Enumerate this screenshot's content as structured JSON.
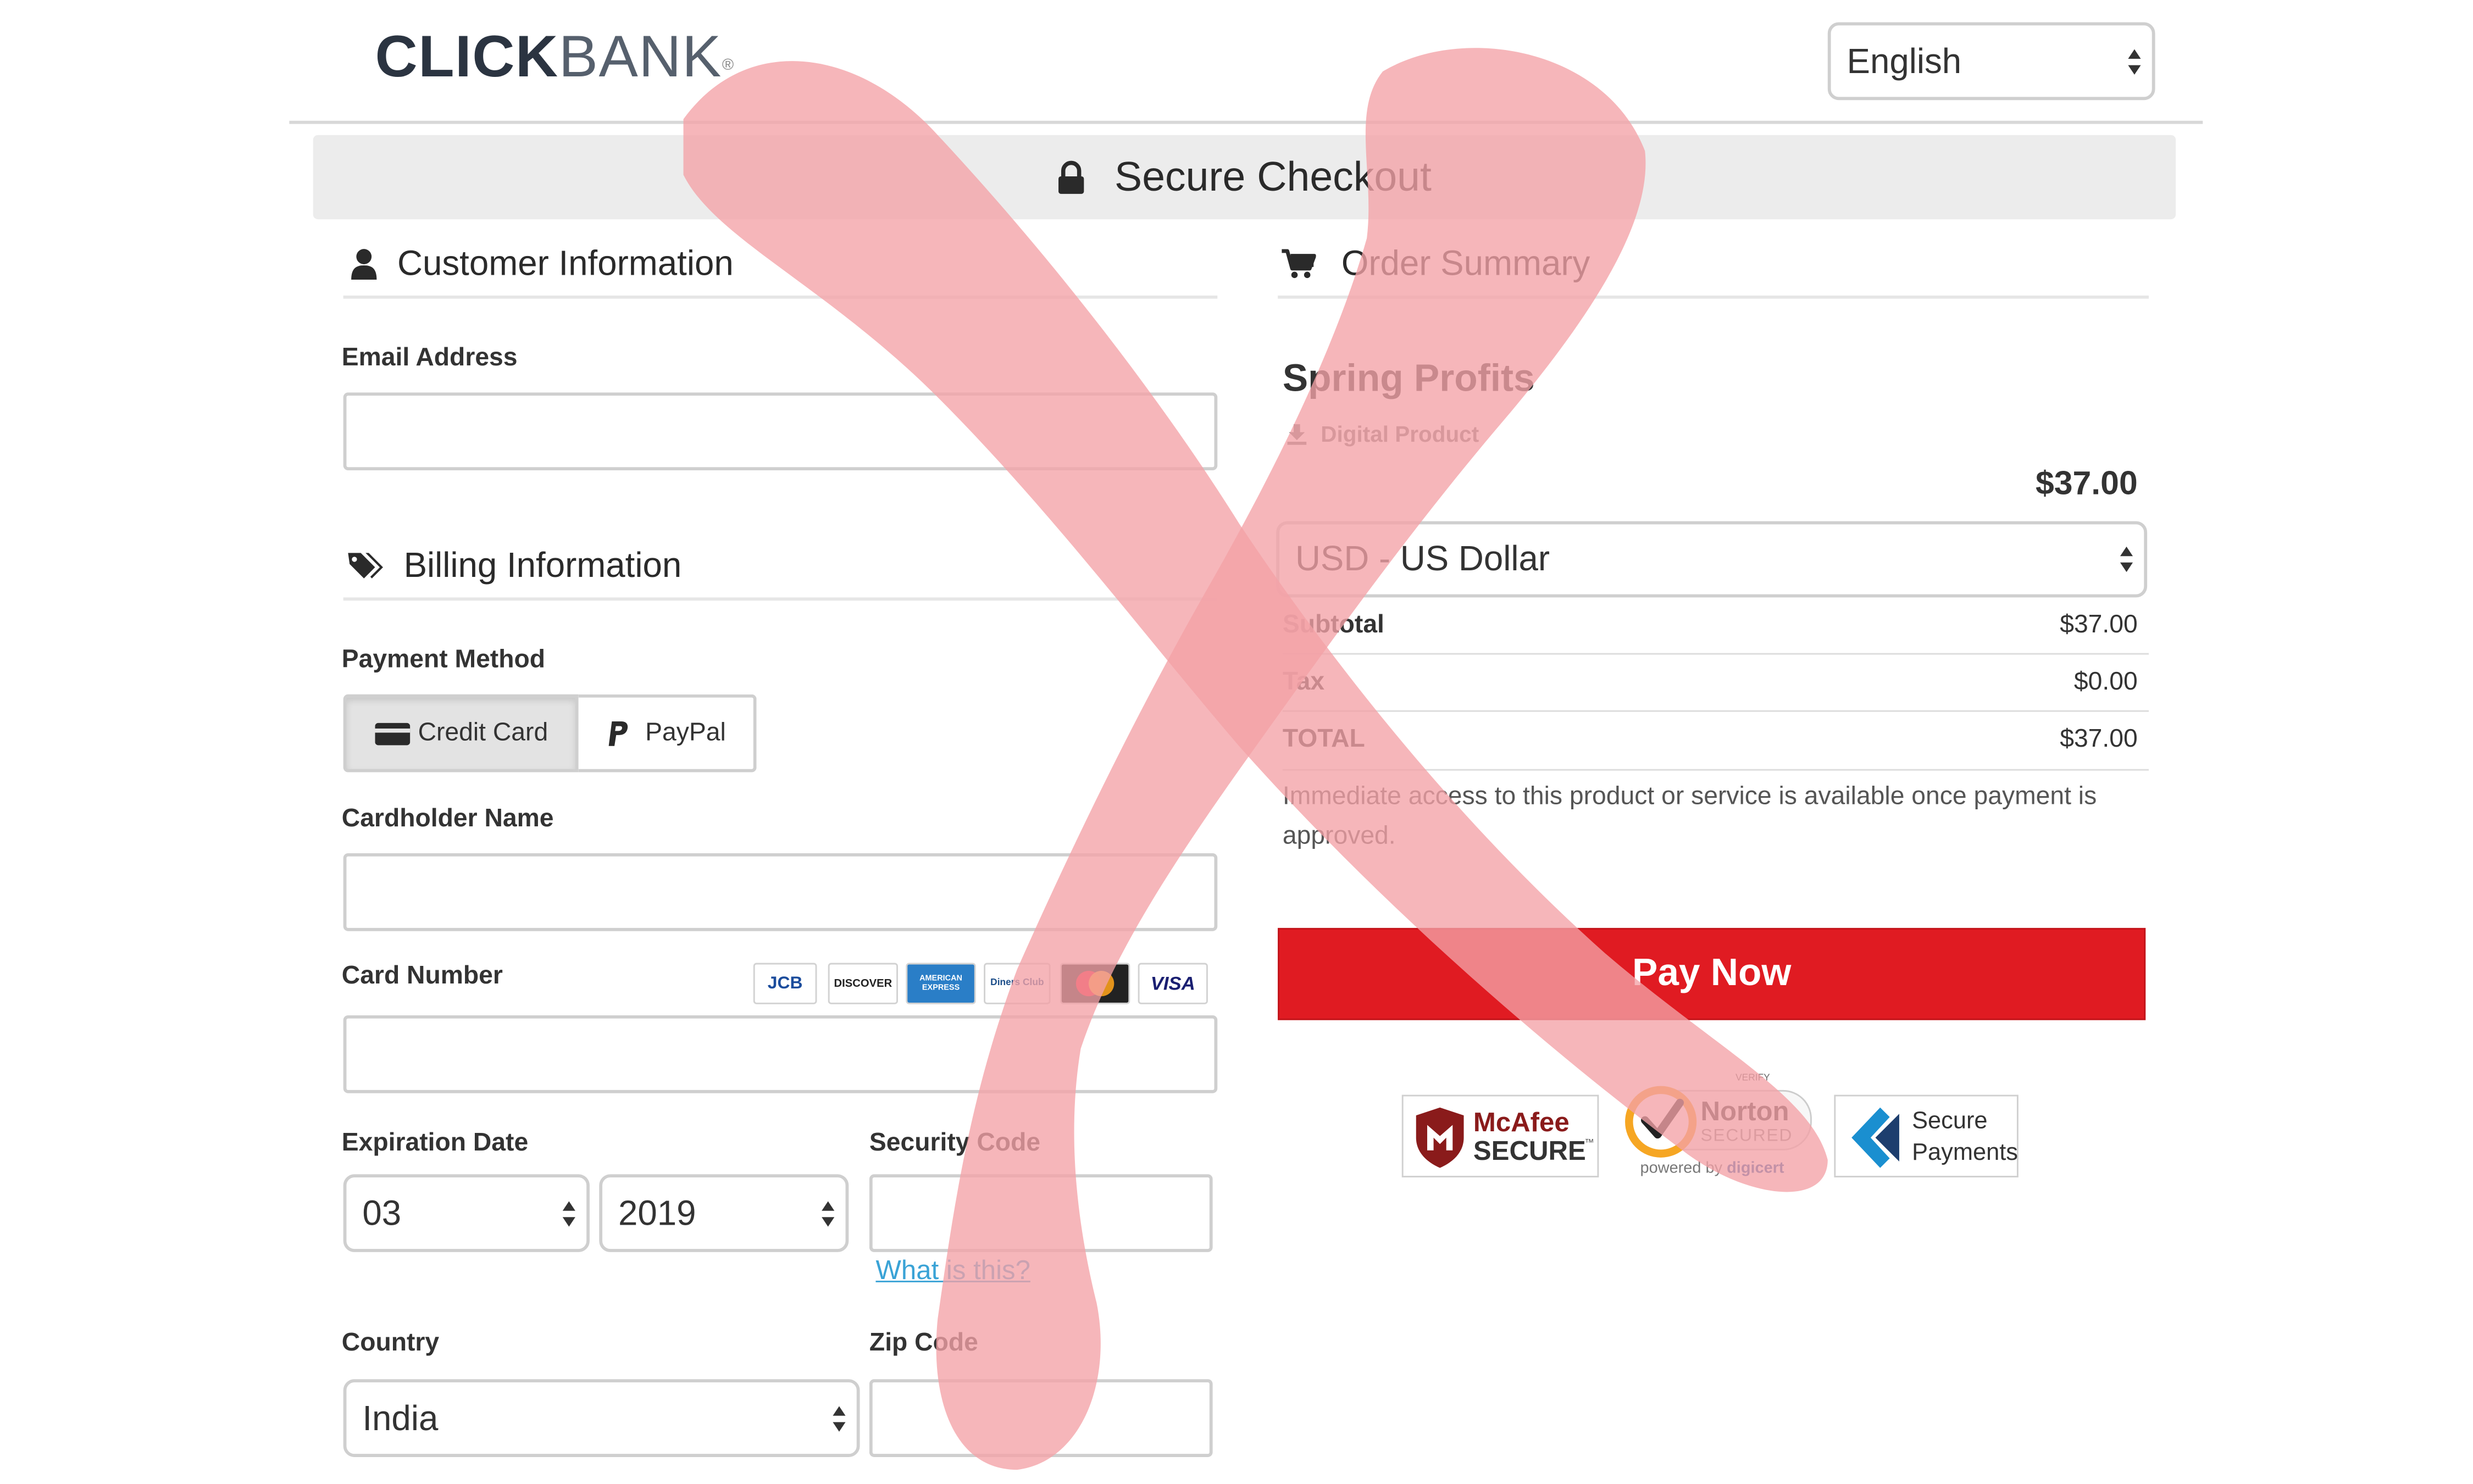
{
  "header": {
    "logo_click": "CLICK",
    "logo_bank": "BANK",
    "logo_mark": "®",
    "language": "English"
  },
  "banner": {
    "title": "Secure Checkout",
    "icon": "lock-icon"
  },
  "customer": {
    "title": "Customer Information",
    "email_label": "Email Address",
    "email_value": ""
  },
  "billing": {
    "title": "Billing Information",
    "payment_method_label": "Payment Method",
    "methods": [
      {
        "label": "Credit Card",
        "icon": "credit-card-icon",
        "selected": true
      },
      {
        "label": "PayPal",
        "icon": "paypal-icon",
        "selected": false
      }
    ],
    "cardholder_label": "Cardholder Name",
    "card_number_label": "Card Number",
    "card_brands": [
      "JCB",
      "DISCOVER",
      "AMERICAN EXPRESS",
      "Diners Club",
      "mastercard",
      "VISA"
    ],
    "expiration_label": "Expiration Date",
    "exp_month": "03",
    "exp_year": "2019",
    "security_label": "Security Code",
    "what_is_this": "What is this?",
    "country_label": "Country",
    "country": "India",
    "zip_label": "Zip Code"
  },
  "order": {
    "title": "Order Summary",
    "product_name": "Spring Profits",
    "product_type": "Digital Product",
    "price": "$37.00",
    "currency": "USD - US Dollar",
    "rows": [
      {
        "label": "Subtotal",
        "value": "$37.00"
      },
      {
        "label": "Tax",
        "value": "$0.00"
      },
      {
        "label": "TOTAL",
        "value": "$37.00"
      }
    ],
    "note": "Immediate access to this product or service is available once payment is approved.",
    "pay_button": "Pay Now"
  },
  "badges": {
    "mcafee_1": "McAfee",
    "mcafee_2": "SECURE",
    "mcafee_tm": "™",
    "norton_verify": "VERIFY",
    "norton_1": "Norton",
    "norton_2": "SECURED",
    "norton_3": "powered by",
    "norton_4": "digicert",
    "secure_1": "Secure",
    "secure_2": "Payments"
  },
  "colors": {
    "pay_button": "#e01b22",
    "link": "#3aa3d6",
    "overlay_x": "#f4a1a7"
  }
}
